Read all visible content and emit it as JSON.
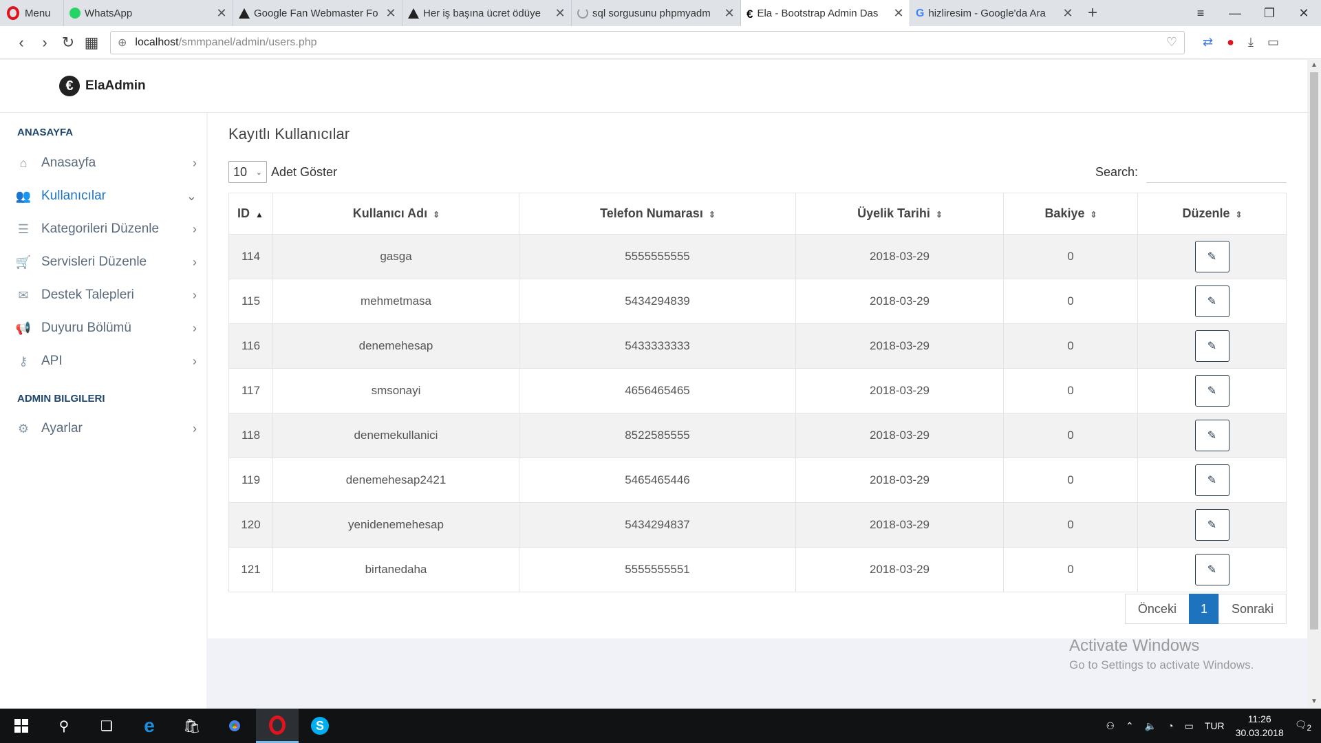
{
  "browser": {
    "menu_label": "Menu",
    "tabs": [
      {
        "title": "WhatsApp",
        "favicon": "whatsapp-icon"
      },
      {
        "title": "Google Fan Webmaster Fo",
        "favicon": "forum-icon"
      },
      {
        "title": "Her iş başına ücret ödüye",
        "favicon": "forum-icon"
      },
      {
        "title": "sql sorgusunu phpmyadm",
        "favicon": "loading-icon"
      },
      {
        "title": "Ela - Bootstrap Admin Das",
        "favicon": "ela-icon",
        "active": true
      },
      {
        "title": "hizliresim - Google'da Ara",
        "favicon": "google-icon"
      }
    ],
    "url_host": "localhost",
    "url_path": "/smmpanel/admin/users.php"
  },
  "brand": {
    "logo": "€",
    "name": "ElaAdmin"
  },
  "sidebar": {
    "section1": "ANASAYFA",
    "items1": [
      {
        "label": "Anasayfa",
        "icon": "home-icon"
      },
      {
        "label": "Kullanıcılar",
        "icon": "users-icon",
        "active": true
      },
      {
        "label": "Kategorileri Düzenle",
        "icon": "list-icon"
      },
      {
        "label": "Servisleri Düzenle",
        "icon": "cart-icon"
      },
      {
        "label": "Destek Talepleri",
        "icon": "envelope-icon"
      },
      {
        "label": "Duyuru Bölümü",
        "icon": "megaphone-icon"
      },
      {
        "label": "API",
        "icon": "key-icon"
      }
    ],
    "section2": "ADMIN BILGILERI",
    "items2": [
      {
        "label": "Ayarlar",
        "icon": "gear-icon"
      }
    ]
  },
  "main": {
    "title": "Kayıtlı Kullanıcılar",
    "page_length": "10",
    "length_label": "Adet Göster",
    "search_label": "Search:",
    "columns": [
      "ID",
      "Kullanıcı Adı",
      "Telefon Numarası",
      "Üyelik Tarihi",
      "Bakiye",
      "Düzenle"
    ],
    "rows": [
      {
        "id": "114",
        "username": "gasga",
        "phone": "5555555555",
        "date": "2018-03-29",
        "balance": "0"
      },
      {
        "id": "115",
        "username": "mehmetmasa",
        "phone": "5434294839",
        "date": "2018-03-29",
        "balance": "0"
      },
      {
        "id": "116",
        "username": "denemehesap",
        "phone": "5433333333",
        "date": "2018-03-29",
        "balance": "0"
      },
      {
        "id": "117",
        "username": "smsonayi",
        "phone": "4656465465",
        "date": "2018-03-29",
        "balance": "0"
      },
      {
        "id": "118",
        "username": "denemekullanici",
        "phone": "8522585555",
        "date": "2018-03-29",
        "balance": "0"
      },
      {
        "id": "119",
        "username": "denemehesap2421",
        "phone": "5465465446",
        "date": "2018-03-29",
        "balance": "0"
      },
      {
        "id": "120",
        "username": "yenidenemehesap",
        "phone": "5434294837",
        "date": "2018-03-29",
        "balance": "0"
      },
      {
        "id": "121",
        "username": "birtanedaha",
        "phone": "5555555551",
        "date": "2018-03-29",
        "balance": "0"
      }
    ],
    "pagination": {
      "prev": "Önceki",
      "current": "1",
      "next": "Sonraki"
    }
  },
  "watermark": {
    "line1": "Activate Windows",
    "line2": "Go to Settings to activate Windows."
  },
  "taskbar": {
    "language": "TUR",
    "time": "11:26",
    "date": "30.03.2018",
    "notifications": "2"
  },
  "colors": {
    "accent": "#1e73be",
    "sidebar_text": "#5a6a7c",
    "opera_red": "#e0141e"
  }
}
